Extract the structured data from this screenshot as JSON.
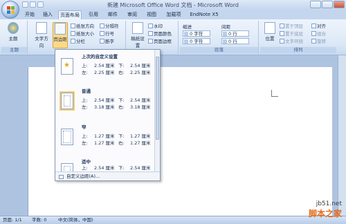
{
  "window": {
    "title": "新建 Microsoft Office Word 文档 - Microsoft Word"
  },
  "tabs": [
    {
      "label": "开始",
      "active": false
    },
    {
      "label": "插入",
      "active": false
    },
    {
      "label": "页面布局",
      "active": true
    },
    {
      "label": "引用",
      "active": false
    },
    {
      "label": "邮件",
      "active": false
    },
    {
      "label": "审阅",
      "active": false
    },
    {
      "label": "视图",
      "active": false
    },
    {
      "label": "加载项",
      "active": false
    },
    {
      "label": "EndNote X5",
      "active": false
    }
  ],
  "ribbon": {
    "theme_group": {
      "label": "主题",
      "theme_btn": "主题"
    },
    "page_setup": {
      "text_direction": "文字方向",
      "margins": "页边距",
      "orientation": "纸张方向",
      "size": "纸张大小",
      "columns": "分栏",
      "breaks": "分隔符",
      "line_numbers": "行号",
      "hyphenation": "断字"
    },
    "page_background": {
      "manuscript": "稿纸设置",
      "watermark": "水印",
      "page_color": "页面颜色",
      "page_border": "页面边框"
    },
    "paragraph": {
      "label": "段落",
      "indent": "缩进",
      "spacing": "间距",
      "indent_left": "0 字符",
      "indent_right": "0 字符",
      "spacing_before": "0 行",
      "spacing_after": "0 行"
    },
    "arrange": {
      "label": "排列",
      "position": "位置",
      "bring_front": "置于顶层",
      "send_back": "置于底层",
      "wrap": "文字环绕",
      "align": "对齐",
      "group": "组合",
      "rotate": "旋转"
    }
  },
  "margins_dropdown": {
    "presets": [
      {
        "name": "上次的自定义设置",
        "top_label": "上:",
        "top": "2.54 厘米",
        "bottom_label": "下:",
        "bottom": "2.54 厘米",
        "left_label": "左:",
        "left": "2.25 厘米",
        "right_label": "右:",
        "right": "2.25 厘米",
        "icon": "star"
      },
      {
        "name": "普通",
        "top_label": "上:",
        "top": "2.54 厘米",
        "bottom_label": "下:",
        "bottom": "2.54 厘米",
        "left_label": "左:",
        "left": "3.18 厘米",
        "right_label": "右:",
        "right": "3.18 厘米",
        "icon": "page"
      },
      {
        "name": "窄",
        "top_label": "上:",
        "top": "1.27 厘米",
        "bottom_label": "下:",
        "bottom": "1.27 厘米",
        "left_label": "左:",
        "left": "1.27 厘米",
        "right_label": "右:",
        "right": "1.27 厘米",
        "icon": "page"
      },
      {
        "name": "适中",
        "top_label": "上:",
        "top": "2.54 厘米",
        "bottom_label": "下:",
        "bottom": "2.54 厘米",
        "left_label": "左:",
        "left": "1.91 厘米",
        "right_label": "右:",
        "right": "1.91 厘米",
        "icon": "page"
      }
    ],
    "custom": "自定义边距(A)..."
  },
  "status": {
    "page": "页面: 1/1",
    "words": "字数: 0",
    "language": "中文(简体，中国)"
  },
  "watermark_site": "jb51.net",
  "watermark_name": "脚本之家"
}
